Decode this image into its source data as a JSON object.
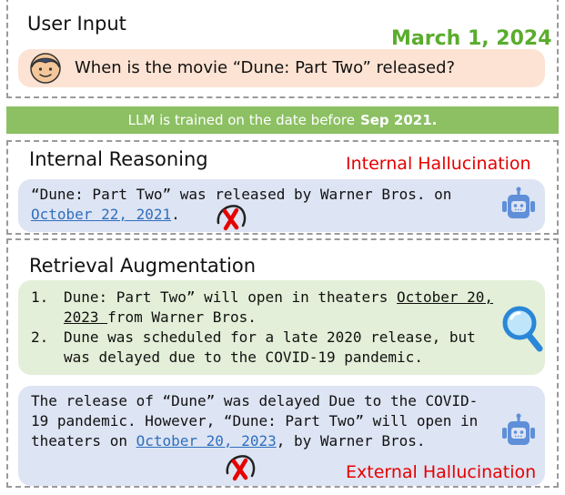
{
  "user_input": {
    "title": "User Input",
    "date": "March 1, 2024",
    "question": "When is the movie “Dune: Part Two” released?",
    "avatar_icon": "user-avatar-icon"
  },
  "banner": {
    "text": "LLM is trained on the date before",
    "bold": "Sep 2021."
  },
  "internal": {
    "title": "Internal Reasoning",
    "label": "Internal Hallucination",
    "answer_pre": "“Dune: Part Two”  was released by Warner Bros. on ",
    "answer_date": "October 22, 2021",
    "answer_post": ".",
    "robot_icon": "robot-icon",
    "mark_icon": "red-cross-icon"
  },
  "retrieval": {
    "title": "Retrieval Augmentation",
    "docs": [
      {
        "num": "1.",
        "pre": "Dune: Part Two” will open in theaters ",
        "date": "October 20, 2023 ",
        "post": "from Warner Bros."
      },
      {
        "num": "2.",
        "pre": "Dune was scheduled for a late 2020 release, but was delayed due to the COVID-19 pandemic.",
        "date": "",
        "post": ""
      }
    ],
    "answer_pre": "The release of “Dune” was delayed Due to the COVID-19 pandemic. However, “Dune: Part Two” will open in theaters on ",
    "answer_date": "October 20, 2023",
    "answer_post": ", by Warner Bros.",
    "label": "External Hallucination",
    "search_icon": "magnifier-icon",
    "robot_icon": "robot-icon",
    "mark_icon": "red-cross-icon"
  },
  "colors": {
    "date_green": "#5aac2d",
    "hallucination_red": "#e60000",
    "link_blue": "#2f6fbd",
    "banner_green": "#8cc063"
  }
}
